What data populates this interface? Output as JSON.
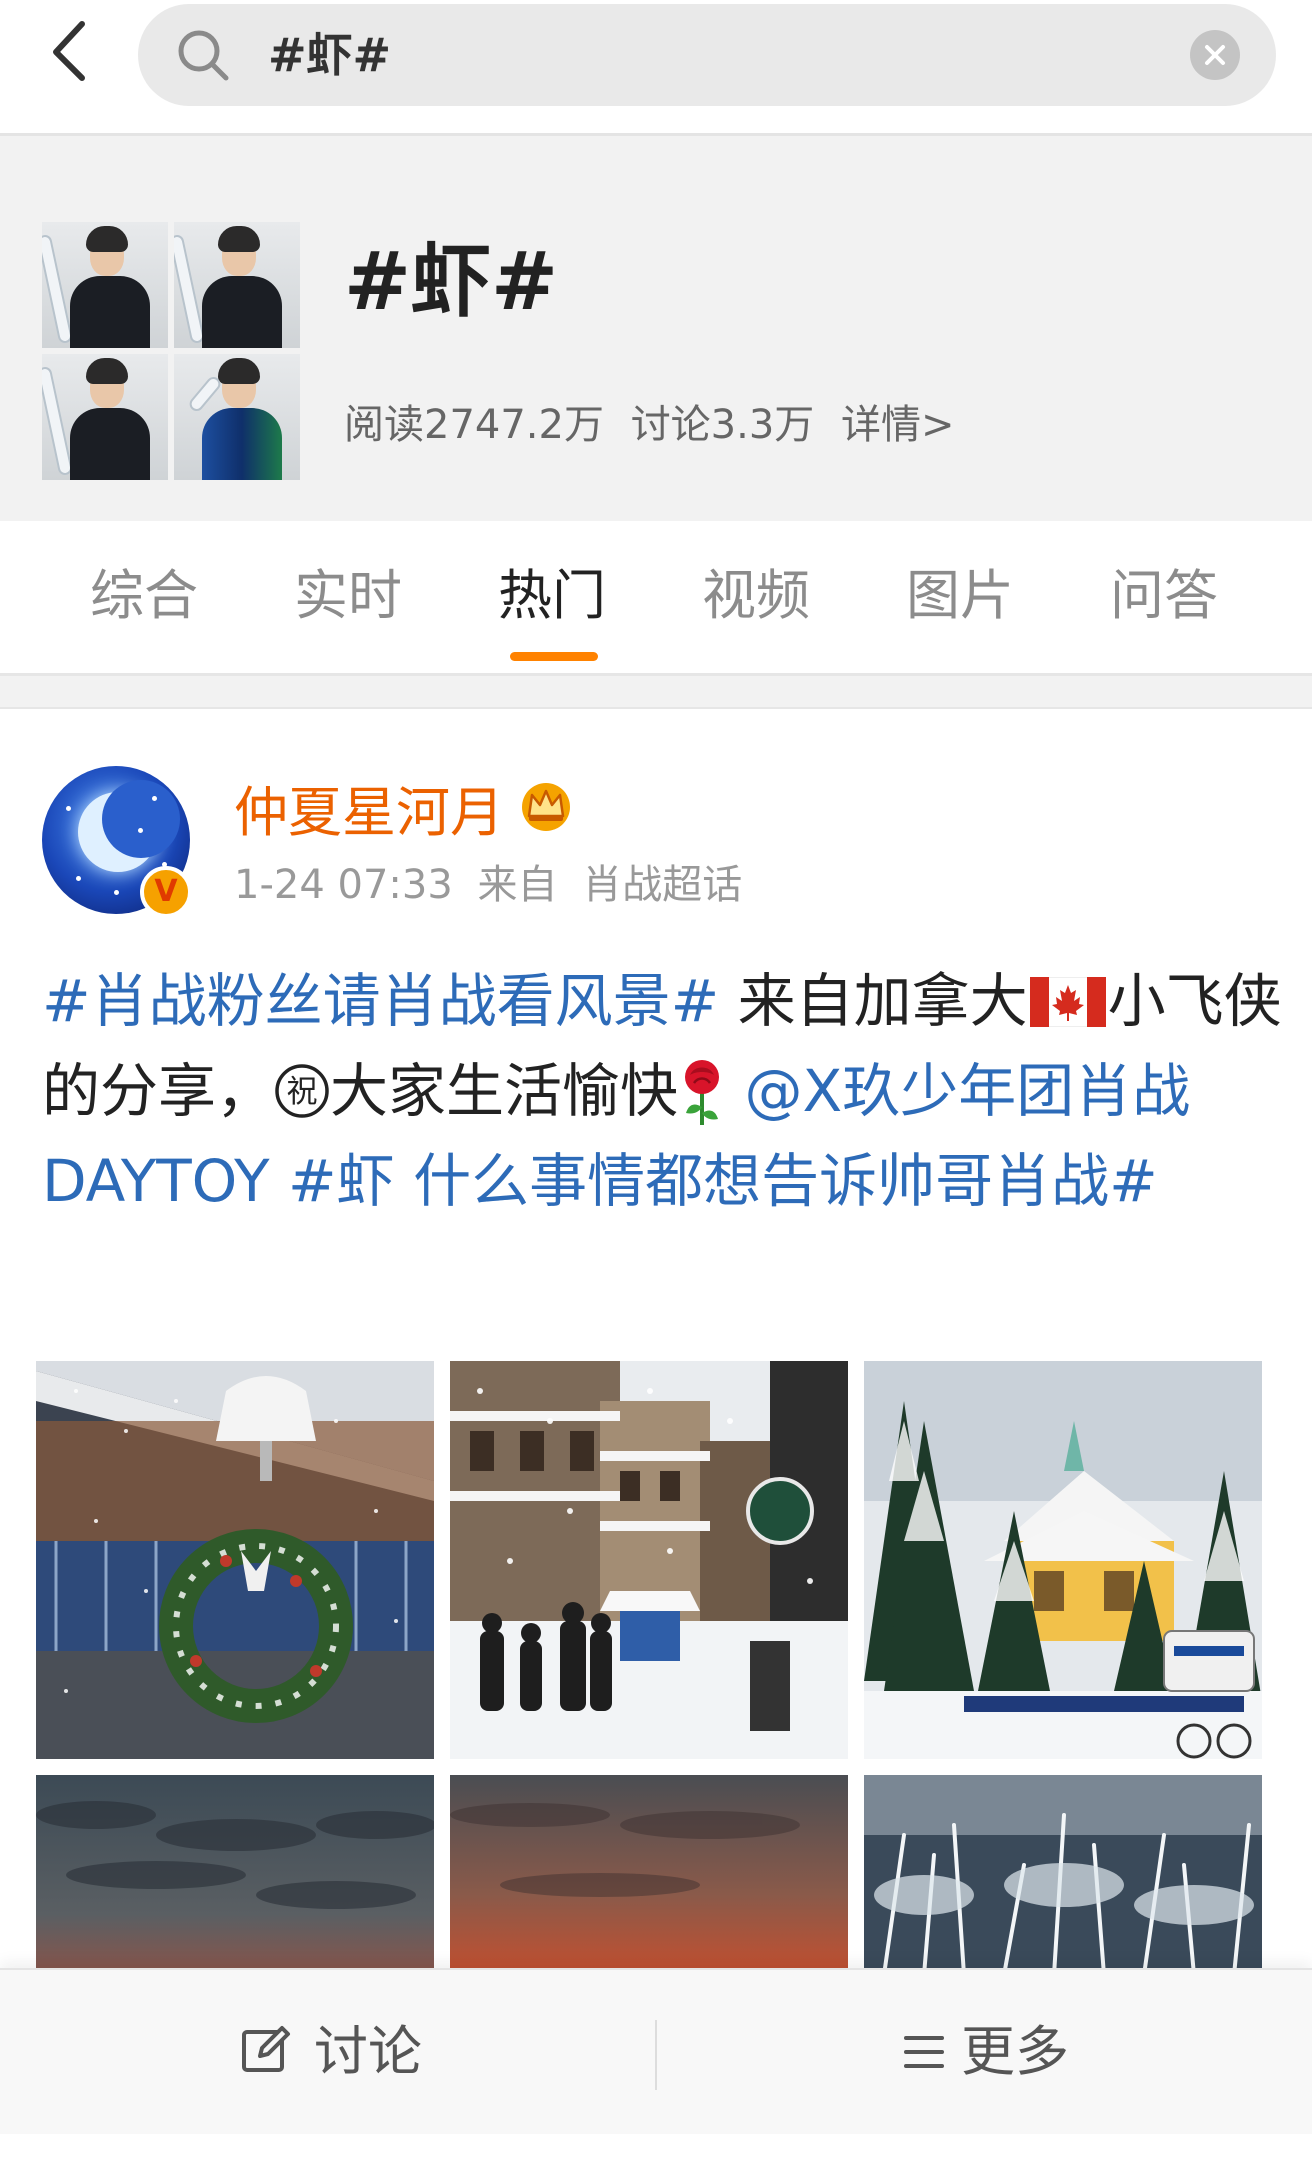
{
  "search": {
    "query": "#虾#"
  },
  "topic": {
    "title": "#虾#",
    "reads": "阅读2747.2万",
    "discussions": "讨论3.3万",
    "details_link": "详情>"
  },
  "tabs": [
    {
      "label": "综合",
      "active": false
    },
    {
      "label": "实时",
      "active": false
    },
    {
      "label": "热门",
      "active": true
    },
    {
      "label": "视频",
      "active": false
    },
    {
      "label": "图片",
      "active": false
    },
    {
      "label": "问答",
      "active": false
    }
  ],
  "post": {
    "user_name": "仲夏星河月",
    "verified_badge": "V",
    "time": "1-24 07:33",
    "source_prefix": "来自",
    "source": "肖战超话",
    "text": {
      "hashtag1": "#肖战粉丝请肖战看风景#",
      "body1": " 来自加拿大",
      "body2": "小飞侠的分享，",
      "body3": "大家生活愉快",
      "mention": "@X玖少年团肖战DAYTOY",
      "hashtag2": " #虾 什么事情都想告诉帅哥肖战#"
    },
    "emoji": [
      "canada-flag-icon",
      "congrats-circle-icon",
      "rose-icon"
    ],
    "photos": [
      "snowy-building-wreath",
      "snowy-village-street",
      "snowy-lodge-trees",
      "red-cloud-sky",
      "red-sunrise-sky",
      "frosted-grass"
    ]
  },
  "bottom_bar": {
    "discuss_label": "讨论",
    "more_label": "更多"
  },
  "colors": {
    "accent_orange": "#ff8200",
    "username_orange": "#eb6100",
    "link_blue": "#2d6bb8",
    "header_bg": "#f2f2f2"
  }
}
